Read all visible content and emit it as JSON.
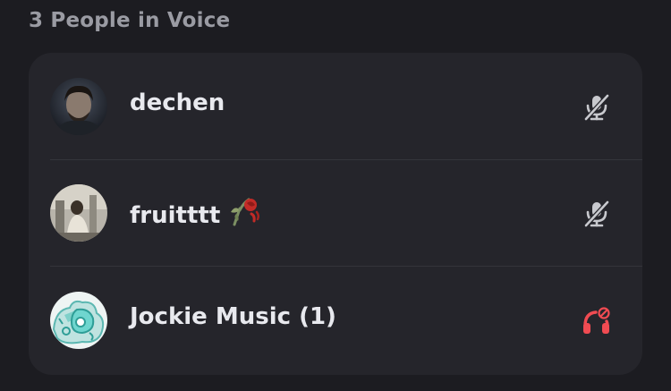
{
  "voice_channel": {
    "header": "3 People in Voice",
    "members": [
      {
        "name": "dechen",
        "status_icon": "muted-mic-icon"
      },
      {
        "name": "fruitttt",
        "emoji": "wilted-rose",
        "status_icon": "muted-mic-icon"
      },
      {
        "name": "Jockie Music (1)",
        "status_icon": "deafened-headphones-icon"
      }
    ]
  },
  "colors": {
    "background": "#1c1c21",
    "card": "#25252b",
    "text": "#e8e9ee",
    "muted_text": "#9a9ba3",
    "icon_gray": "#c8c9ce",
    "deafened_red": "#f04b52"
  }
}
